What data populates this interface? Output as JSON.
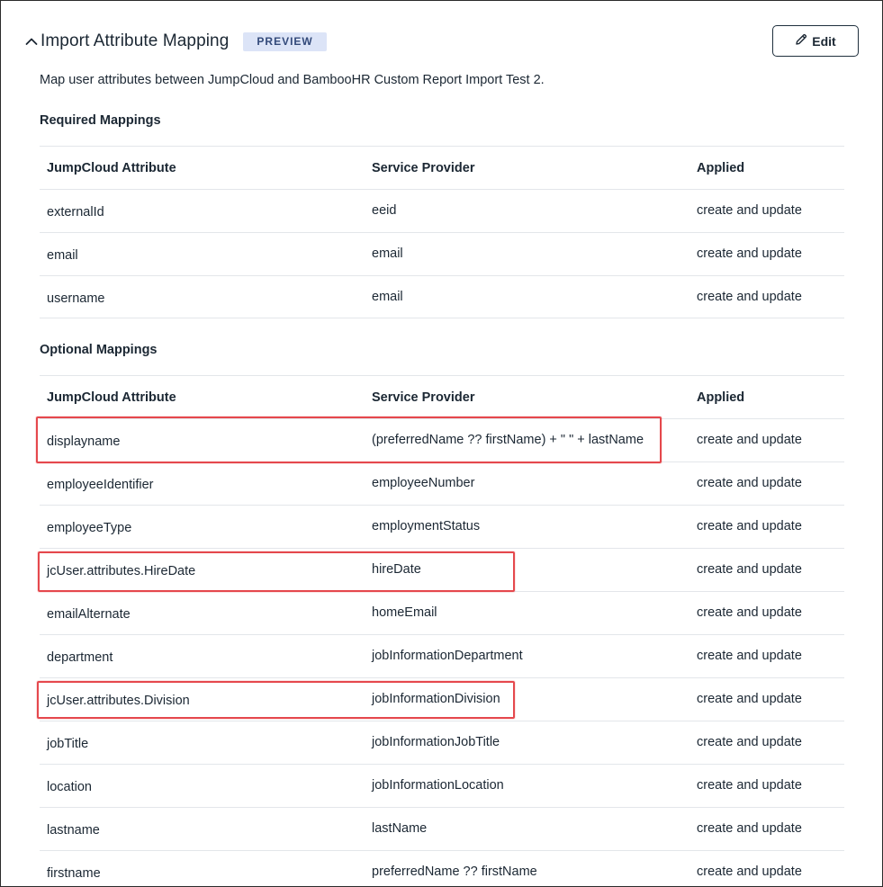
{
  "header": {
    "title": "Import Attribute Mapping",
    "badge": "PREVIEW",
    "edit_label": "Edit",
    "icons": {
      "collapse": "chevron-up-icon",
      "edit": "pencil-icon"
    }
  },
  "description": "Map user attributes between JumpCloud and BambooHR Custom Report Import Test 2.",
  "required": {
    "label": "Required Mappings",
    "columns": [
      "JumpCloud Attribute",
      "Service Provider",
      "Applied"
    ],
    "rows": [
      [
        "externalId",
        "eeid",
        "create and update"
      ],
      [
        "email",
        "email",
        "create and update"
      ],
      [
        "username",
        "email",
        "create and update"
      ]
    ]
  },
  "optional": {
    "label": "Optional Mappings",
    "columns": [
      "JumpCloud Attribute",
      "Service Provider",
      "Applied"
    ],
    "rows": [
      [
        "displayname",
        "(preferredName ?? firstName) + \" \" + lastName",
        "create and update"
      ],
      [
        "employeeIdentifier",
        "employeeNumber",
        "create and update"
      ],
      [
        "employeeType",
        "employmentStatus",
        "create and update"
      ],
      [
        "jcUser.attributes.HireDate",
        "hireDate",
        "create and update"
      ],
      [
        "emailAlternate",
        "homeEmail",
        "create and update"
      ],
      [
        "department",
        "jobInformationDepartment",
        "create and update"
      ],
      [
        "jcUser.attributes.Division",
        "jobInformationDivision",
        "create and update"
      ],
      [
        "jobTitle",
        "jobInformationJobTitle",
        "create and update"
      ],
      [
        "location",
        "jobInformationLocation",
        "create and update"
      ],
      [
        "lastname",
        "lastName",
        "create and update"
      ],
      [
        "firstname",
        "preferredName ?? firstName",
        "create and update"
      ]
    ]
  },
  "colors": {
    "highlight": "#e5484d",
    "badge_bg": "#dce4f7",
    "text": "#1b2733"
  }
}
